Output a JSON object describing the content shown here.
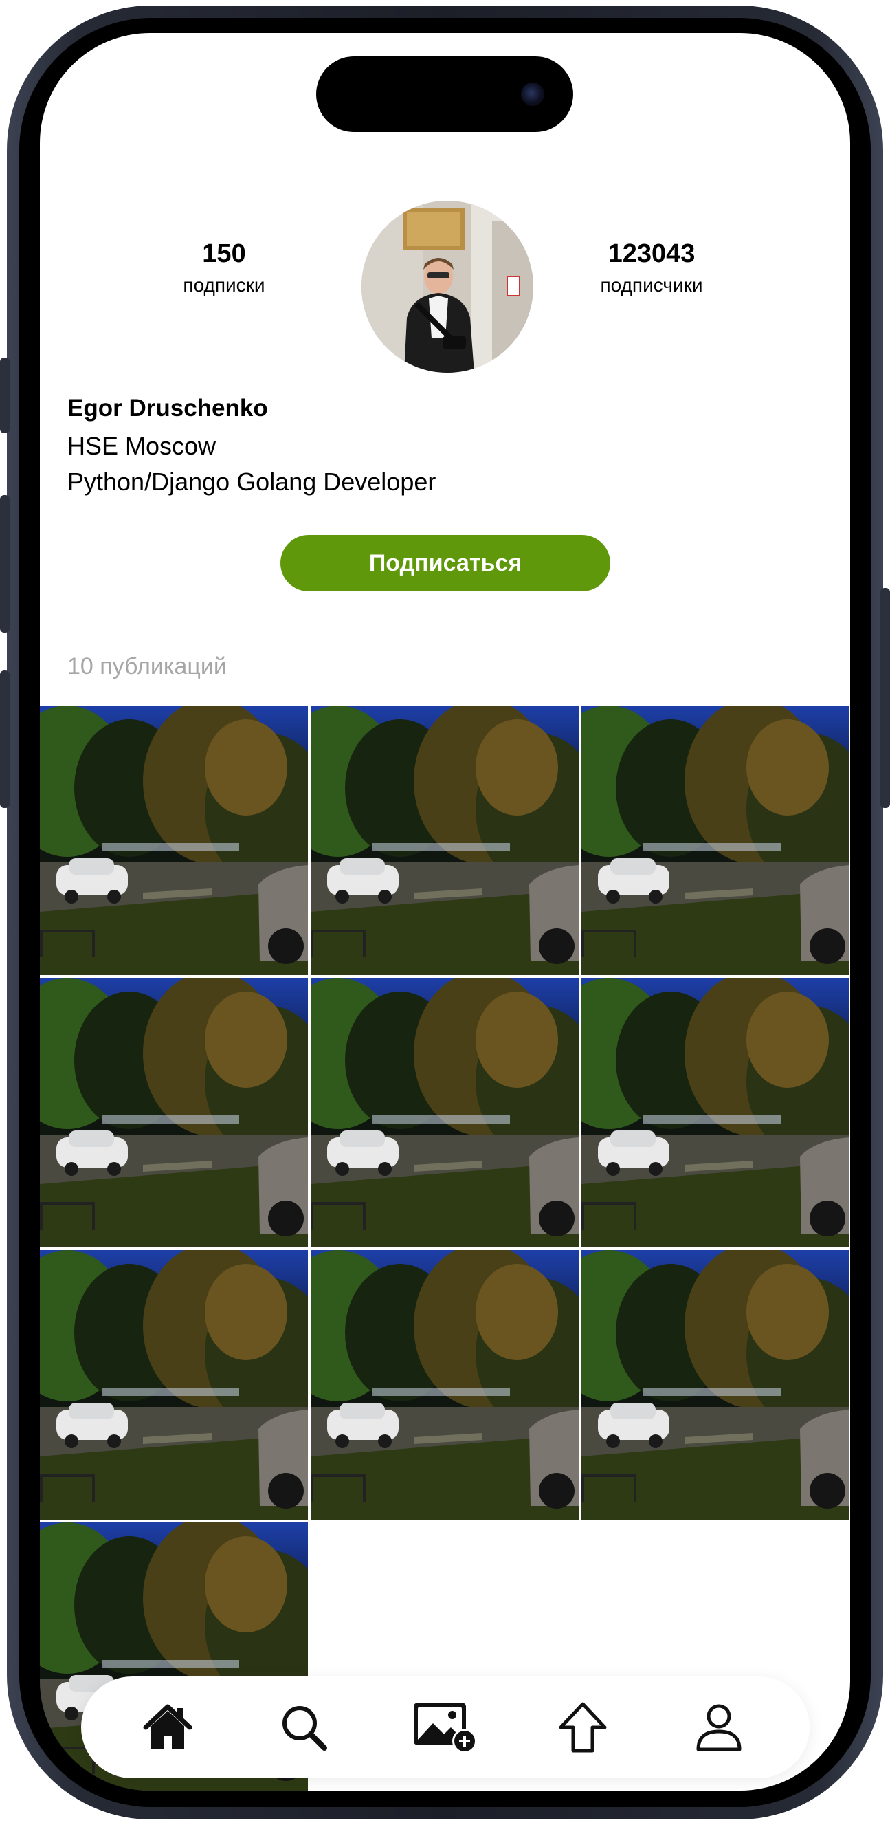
{
  "profile": {
    "following_count": "150",
    "following_label": "подписки",
    "followers_count": "123043",
    "followers_label": "подписчики",
    "name": "Egor Druschenko",
    "bio_line1": "HSE Moscow",
    "bio_line2": "Python/Django Golang Developer"
  },
  "actions": {
    "follow_label": "Подписаться"
  },
  "posts": {
    "count_label": "10 публикаций",
    "count": 10
  },
  "colors": {
    "accent": "#5f990b",
    "muted_text": "#a6a6a6"
  },
  "tabbar": {
    "items": [
      {
        "icon": "home-icon"
      },
      {
        "icon": "search-icon"
      },
      {
        "icon": "add-photo-icon"
      },
      {
        "icon": "upload-icon"
      },
      {
        "icon": "profile-icon"
      }
    ]
  }
}
